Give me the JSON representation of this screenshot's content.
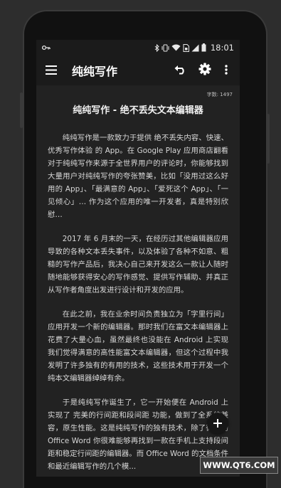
{
  "statusbar": {
    "time": "18:01",
    "icons": [
      "key-icon",
      "bluetooth-icon",
      "vibrate-icon",
      "wifi-icon",
      "sim-icon",
      "signal-icon",
      "battery-icon"
    ]
  },
  "appbar": {
    "title": "纯纯写作",
    "icons": [
      "menu-icon",
      "undo-icon",
      "settings-icon",
      "more-vert-icon"
    ]
  },
  "document": {
    "word_count": "字数: 1497",
    "title": "纯纯写作 - 绝不丢失文本编辑器",
    "paragraphs": [
      "纯纯写作是一款致力于提供 绝不丢失内容、快速、优秀写作体验 的 App。在 Google Play 应用商店翻看对于纯纯写作来源于全世界用户的评论时，你能够找到大量用户对纯纯写作的夸张赞美，比如「没用过这么好用的 App」、「最满意的 App」、「爱死这个 App」、「一见倾心」… 作为这个应用的唯一开发者，真是特别欣慰…",
      "2017 年 6 月末的一天，在经历过其他编辑器应用导致的各种文本丢失事件，以及体验了各种不如意、粗糙的写作产品后，我决心自己来开发这么一款让人随时随地能够获得安心的写作感觉、提供写作辅助、并真正从写作者角度出发进行设计和开发的应用。",
      "在此之前，我在业余时间负责独立为「字里行间」应用开发一个新的编辑器。那时我们在富文本编辑器上花费了大量心血，虽然最终也没能在 Android 上实现我们觉得满意的高性能富文本编辑器，但这个过程中我发明了许多独有的有用的技术，这些技术用于开发一个纯本文编辑器绰绰有余。",
      "于是纯纯写作诞生了，它一开始便在 Android 上实现了 完美的行间距和段间距 功能，做到了全系统兼容，原生性能。这是纯纯写作的独有技术，除了微软的 Office Word 你很难能够再找到一款在手机上支持段间距和稳定行间距的编辑器。而 Office Word 的文档条件和最近编辑写作的几个模..."
    ]
  },
  "fab": {
    "icon": "plus-icon"
  },
  "watermark": {
    "text": "WWW.QT6.COM"
  },
  "colors": {
    "background": "#222222",
    "appbar": "#1b1b1b",
    "text": "#d8d8d8"
  }
}
